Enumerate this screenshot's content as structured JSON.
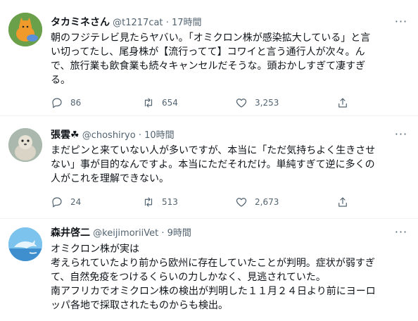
{
  "tweets": [
    {
      "name": "タカミネさん",
      "handle": "@t1217cat",
      "dot": "·",
      "time": "17時間",
      "more": "···",
      "lines": [
        "朝のフジテレビ見たらヤバい。「オミクロン株が感染拡大している」と言",
        "い切ってたし、尾身株が【流行ってて】コワイと言う通行人が次々。ん",
        "で、旅行業も飲食業も続々キャンセルだそうな。頭おかしすぎて凄すぎ",
        "る。"
      ],
      "replies": "86",
      "retweets": "654",
      "likes": "3,253"
    },
    {
      "name": "張雲☘",
      "handle": "@choshiryo",
      "dot": "·",
      "time": "10時間",
      "more": "···",
      "lines": [
        "まだピンと来ていない人が多いですが、本当に「ただ気持ちよく生きさせ",
        "ない」事が目的なんですよ。本当にただそれだけ。単純すぎて逆に多くの",
        "人がこれを理解できない。"
      ],
      "replies": "24",
      "retweets": "513",
      "likes": "2,673"
    },
    {
      "name": "森井啓二",
      "handle": "@keijimoriiVet",
      "dot": "·",
      "time": "9時間",
      "more": "···",
      "lines": [
        "オミクロン株が実は",
        "考えられていたより前から欧州に存在していたことが判明。症状が弱すぎ",
        "て、自然免疫をつけるくらいの力しかなく、見逃されていた。",
        "南アフリカでオミクロン株の検出が判明した１１月２４日より前にヨーロ",
        "ッパ各地で採取されたものからも検出。"
      ]
    }
  ],
  "colors": {
    "text": "#0f1419",
    "muted": "#536471",
    "border": "#eff3f4"
  }
}
